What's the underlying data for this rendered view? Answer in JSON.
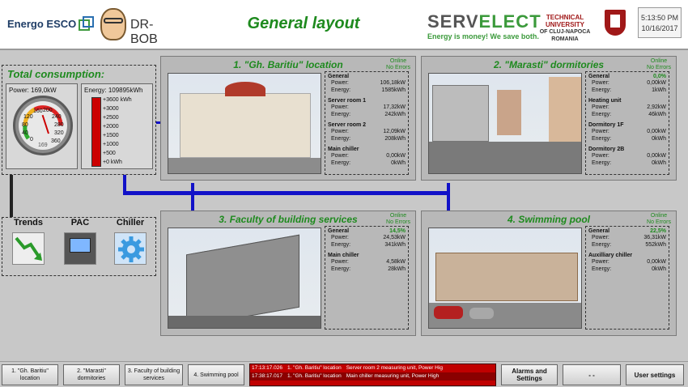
{
  "header": {
    "energo_label": "Energo ESCO",
    "drbob_label": "DR-BOB",
    "title": "General layout",
    "servelect_a": "SERV",
    "servelect_b": "ELECT",
    "servelect_tagline": "Energy is money! We save both.",
    "tu_line1": "TECHNICAL UNIVERSITY",
    "tu_line2": "OF CLUJ-NAPOCA",
    "tu_line3": "ROMANIA",
    "time": "5:13:50 PM",
    "date": "10/16/2017"
  },
  "total": {
    "title": "Total consumption:",
    "power_label": "Power:",
    "power_value": "169,0kW",
    "energy_label": "Energy:",
    "energy_value": "109895kWh",
    "gauge_ticks": [
      "0",
      "40",
      "80",
      "120",
      "160",
      "200",
      "240",
      "280",
      "320",
      "360"
    ],
    "gauge_value": "169",
    "thermo_ticks": [
      "+3600 kWh",
      "+3000",
      "+2500",
      "+2000",
      "+1500",
      "+1000",
      "+500",
      "+0 kWh"
    ]
  },
  "controls": [
    {
      "label": "Trends",
      "icon": "trend-down-icon"
    },
    {
      "label": "PAC",
      "icon": "power-meter-icon"
    },
    {
      "label": "Chiller",
      "icon": "gear-icon"
    }
  ],
  "locations": [
    {
      "title": "1. \"Gh. Baritiu\" location",
      "status1": "Online",
      "status2": "No Errors",
      "groups": [
        {
          "name": "General",
          "pct": "",
          "power": "106,18kW",
          "energy": "1585kWh"
        },
        {
          "name": "Server room 1",
          "pct": "",
          "power": "17,32kW",
          "energy": "242kWh"
        },
        {
          "name": "Server room 2",
          "pct": "",
          "power": "12,09kW",
          "energy": "208kWh"
        },
        {
          "name": "Main chiller",
          "pct": "",
          "power": "0,00kW",
          "energy": "0kWh"
        }
      ]
    },
    {
      "title": "2. \"Marasti\" dormitories",
      "status1": "Online",
      "status2": "No Errors",
      "groups": [
        {
          "name": "General",
          "pct": "0,0%",
          "power": "0,00kW",
          "energy": "1kWh"
        },
        {
          "name": "Heating unit",
          "pct": "",
          "power": "2,92kW",
          "energy": "46kWh"
        },
        {
          "name": "Dormitory 1F",
          "pct": "",
          "power": "0,00kW",
          "energy": "0kWh"
        },
        {
          "name": "Dormitory 2B",
          "pct": "",
          "power": "0,00kW",
          "energy": "0kWh"
        }
      ]
    },
    {
      "title": "3. Faculty of building services",
      "status1": "Online",
      "status2": "No Errors",
      "groups": [
        {
          "name": "General",
          "pct": "14,5%",
          "power": "24,53kW",
          "energy": "341kWh"
        },
        {
          "name": "Main chiller",
          "pct": "",
          "power": "4,58kW",
          "energy": "28kWh"
        }
      ]
    },
    {
      "title": "4. Swimming pool",
      "status1": "Online",
      "status2": "No Errors",
      "groups": [
        {
          "name": "General",
          "pct": "22,5%",
          "power": "36,31kW",
          "energy": "552kWh"
        },
        {
          "name": "Auxilliary chiller",
          "pct": "",
          "power": "0,00kW",
          "energy": "0kWh"
        }
      ]
    }
  ],
  "stat_labels": {
    "power": "Power:",
    "energy": "Energy:"
  },
  "bottom": {
    "buttons": [
      "1. \"Gh. Baritiu\" location",
      "2. \"Marasti\" dormitories",
      "3. Faculty of building services",
      "4. Swimming pool"
    ],
    "alarms": [
      {
        "time": "17:13:17.026",
        "loc": "1. \"Gh. Baritiu\" location",
        "msg": "Server room 2 measuring unit, Power Hig"
      },
      {
        "time": "17:38:17.017",
        "loc": "1. \"Gh. Baritiu\" location",
        "msg": "Main chiller measuring unit, Power High"
      }
    ],
    "alarms_button": "Alarms and Settings",
    "blank_button": "- -",
    "user_button": "User settings"
  }
}
